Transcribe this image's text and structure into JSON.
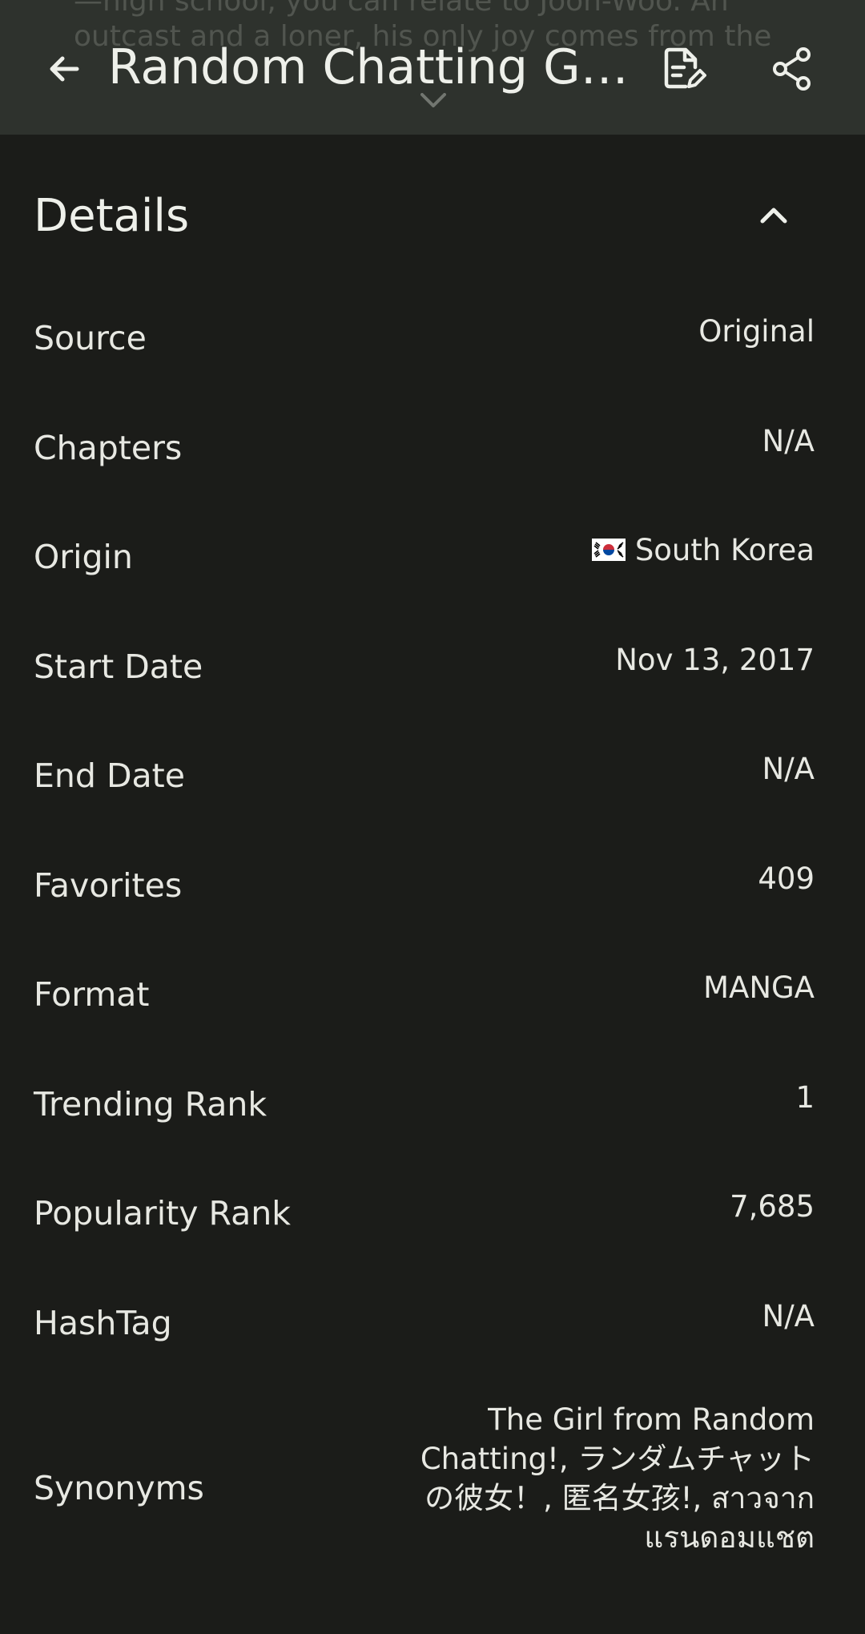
{
  "appbar": {
    "title": "Random Chatting Geu...",
    "background_line_1": "—high school, you can relate to Joon-Woo. An",
    "background_line_2": "outcast and a loner, his only joy comes from the",
    "back_icon": "arrow-back-icon",
    "edit_icon": "edit-note-icon",
    "share_icon": "share-icon"
  },
  "details": {
    "title": "Details",
    "toggle_icon": "chevron-up-icon",
    "rows": [
      {
        "label": "Source",
        "value": "Original"
      },
      {
        "label": "Chapters",
        "value": "N/A"
      },
      {
        "label": "Origin",
        "value": "South Korea",
        "icon": "south-korea-flag-icon"
      },
      {
        "label": "Start Date",
        "value": "Nov 13, 2017"
      },
      {
        "label": "End Date",
        "value": "N/A"
      },
      {
        "label": "Favorites",
        "value": "409"
      },
      {
        "label": "Format",
        "value": "MANGA"
      },
      {
        "label": "Trending Rank",
        "value": "1"
      },
      {
        "label": "Popularity Rank",
        "value": "7,685"
      },
      {
        "label": "HashTag",
        "value": "N/A"
      },
      {
        "label": "Synonyms",
        "value": "The Girl from Random Chatting!, ランダムチャットの彼女！, 匿名女孩!, สาวจากแรนดอมแชต"
      }
    ]
  },
  "colors": {
    "appbar_bg": "#2e322d",
    "page_bg": "#1b1c19",
    "text": "#e7e8e2"
  }
}
